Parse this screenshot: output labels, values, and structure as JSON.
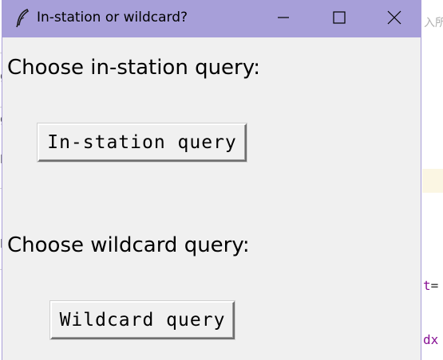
{
  "window": {
    "title": "In-station or wildcard?"
  },
  "titlebar_controls": {
    "minimize_icon": "minimize-icon",
    "maximize_icon": "maximize-icon",
    "close_icon": "close-icon",
    "app_icon": "feather-icon"
  },
  "dialog": {
    "instation_label": "Choose in-station query:",
    "instation_button": "In-station query",
    "wildcard_label": "Choose wildcard query:",
    "wildcard_button": "Wildcard query"
  },
  "background_editor": {
    "hint_text": "入所",
    "code_fragment_1_kw": "t",
    "code_fragment_1_op": "=",
    "code_fragment_2": "dx",
    "gutter_chars": [
      "g",
      "g",
      "b",
      "p"
    ]
  },
  "colors": {
    "titlebar": "#a79fd9",
    "window_bg": "#f0f0f0",
    "keyword": "#871094"
  }
}
